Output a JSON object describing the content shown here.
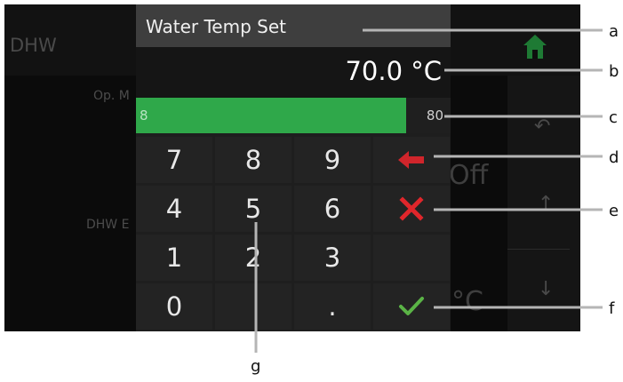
{
  "background": {
    "title": "DHW",
    "op_mode_label": "Op. M",
    "dhw_label": "DHW E",
    "off_text": "Off",
    "unit_text": "°C",
    "home_icon": "home-icon",
    "accent_green": "#1e7a34"
  },
  "dialog": {
    "title": "Water Temp Set",
    "value": "70.0 °C",
    "range_min": "8",
    "range_max": "80",
    "range_fill_fraction": 0.86,
    "range_color": "#2fa84a"
  },
  "keypad": {
    "keys": [
      "7",
      "8",
      "9",
      "4",
      "5",
      "6",
      "1",
      "2",
      "3",
      "0",
      "."
    ],
    "backspace_icon": "backspace-arrow-icon",
    "backspace_color": "#d0252b",
    "clear_icon": "clear-x-icon",
    "clear_color": "#e0262b",
    "confirm_icon": "check-icon",
    "confirm_color": "#5ab346"
  },
  "callouts": [
    "a",
    "b",
    "c",
    "d",
    "e",
    "f",
    "g"
  ]
}
